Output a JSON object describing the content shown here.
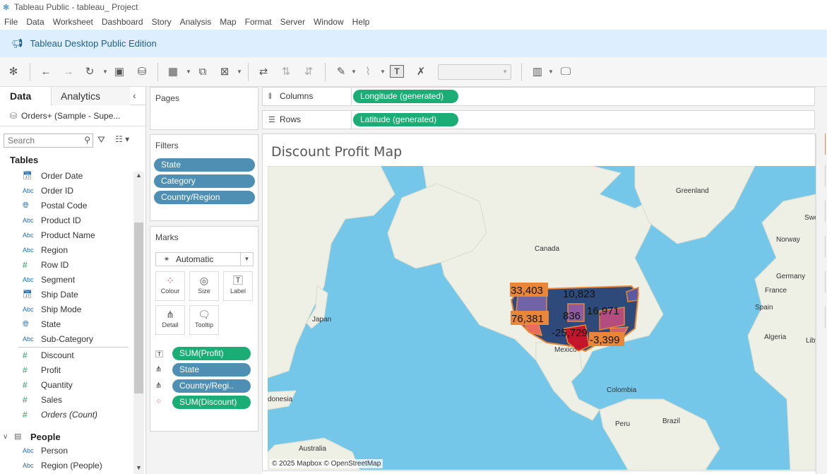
{
  "window": {
    "title": "Tableau Public - tableau_ Project"
  },
  "menu": [
    "File",
    "Data",
    "Worksheet",
    "Dashboard",
    "Story",
    "Analysis",
    "Map",
    "Format",
    "Server",
    "Window",
    "Help"
  ],
  "banner": {
    "text": "Tableau Desktop Public Edition"
  },
  "data_pane": {
    "tabs": {
      "data": "Data",
      "analytics": "Analytics"
    },
    "datasource": "Orders+ (Sample - Supe...",
    "search_placeholder": "Search",
    "tables_heading": "Tables",
    "dimensions": [
      {
        "label": "Order Date",
        "icon": "calendar-icon"
      },
      {
        "label": "Order ID",
        "icon": "abc-icon"
      },
      {
        "label": "Postal Code",
        "icon": "globe-icon"
      },
      {
        "label": "Product ID",
        "icon": "abc-icon"
      },
      {
        "label": "Product Name",
        "icon": "abc-icon"
      },
      {
        "label": "Region",
        "icon": "abc-icon"
      },
      {
        "label": "Row ID",
        "icon": "hash-icon"
      },
      {
        "label": "Segment",
        "icon": "abc-icon"
      },
      {
        "label": "Ship Date",
        "icon": "calendar-icon"
      },
      {
        "label": "Ship Mode",
        "icon": "abc-icon"
      },
      {
        "label": "State",
        "icon": "globe-icon"
      },
      {
        "label": "Sub-Category",
        "icon": "abc-icon"
      }
    ],
    "measures": [
      {
        "label": "Discount",
        "icon": "hash-icon"
      },
      {
        "label": "Profit",
        "icon": "hash-icon"
      },
      {
        "label": "Quantity",
        "icon": "hash-icon"
      },
      {
        "label": "Sales",
        "icon": "hash-icon"
      },
      {
        "label": "Orders (Count)",
        "icon": "hash-icon"
      }
    ],
    "people_table": "People",
    "people_fields": [
      {
        "label": "Person",
        "icon": "abc-icon"
      },
      {
        "label": "Region (People)",
        "icon": "abc-icon"
      }
    ],
    "abc_glyph": "Abc"
  },
  "cards": {
    "pages_title": "Pages",
    "filters_title": "Filters",
    "filters": [
      "State",
      "Category",
      "Country/Region"
    ],
    "marks_title": "Marks",
    "marks_type": "Automatic",
    "mark_buttons": [
      "Colour",
      "Size",
      "Label",
      "Detail",
      "Tooltip"
    ],
    "mark_fields": [
      {
        "label": "SUM(Profit)",
        "icon": "label-icon",
        "color": "green"
      },
      {
        "label": "State",
        "icon": "detail-icon",
        "color": "blue"
      },
      {
        "label": "Country/Regi..",
        "icon": "detail-icon",
        "color": "blue"
      },
      {
        "label": "SUM(Discount)",
        "icon": "colour-icon",
        "color": "green"
      }
    ]
  },
  "shelves": {
    "columns_label": "Columns",
    "columns_pill": "Longitude (generated)",
    "rows_label": "Rows",
    "rows_pill": "Latitude (generated)"
  },
  "viz": {
    "title": "Discount Profit Map",
    "place_labels": [
      "Greenland",
      "Canada",
      "Swed",
      "Norway",
      "Germany",
      "France",
      "Spain",
      "Algeria",
      "Libya",
      "Japan",
      "Mexico",
      "Colombia",
      "Peru",
      "Brazil",
      "Australia",
      "donesia"
    ],
    "data_labels": [
      "33,403",
      "10,823",
      "16,971",
      "836",
      "76,381",
      "-25,729",
      "-3,399"
    ],
    "attribution": "© 2025 Mapbox © OpenStreetMap"
  },
  "colors": {
    "accent_green": "#1aae76",
    "accent_blue": "#4e8fb3",
    "ocean": "#75c7ea",
    "land": "#eef0e6",
    "banner": "#ddeeff"
  }
}
